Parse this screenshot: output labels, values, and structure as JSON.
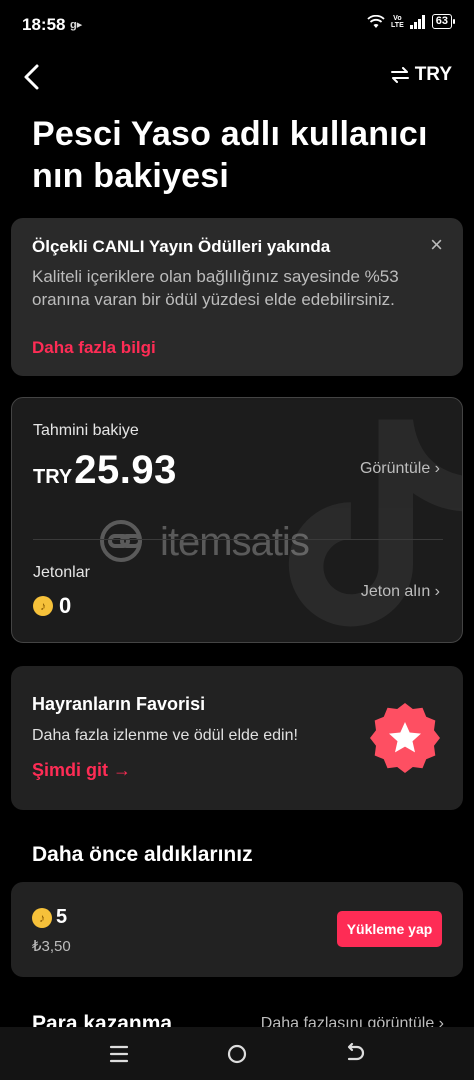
{
  "status_bar": {
    "time": "18:58",
    "network_label": "g▸",
    "volte_top": "Vo",
    "volte_bottom": "LTE",
    "battery": "63"
  },
  "header": {
    "currency_label": "TRY"
  },
  "title": "Pesci Yaso adlı kullanıcı nın bakiyesi",
  "notice": {
    "title": "Ölçekli CANLI Yayın Ödülleri yakında",
    "body": "Kaliteli içeriklere olan bağlılığınız sayesinde %53 oranına varan bir ödül yüzdesi elde edebilirsiniz.",
    "link": "Daha fazla bilgi",
    "close": "×"
  },
  "balance": {
    "label": "Tahmini bakiye",
    "currency": "TRY",
    "amount": "25.93",
    "view_link": "Görüntüle ›",
    "coins_label": "Jetonlar",
    "coins_value": "0",
    "buy_link": "Jeton alın ›",
    "watermark": "itemsatis"
  },
  "fans": {
    "title": "Hayranların Favorisi",
    "body": "Daha fazla izlenme ve ödül elde edin!",
    "link": "Şimdi git →"
  },
  "previous": {
    "section_title": "Daha önce aldıklarınız",
    "coins": "5",
    "price": "₺3,50",
    "button": "Yükleme yap"
  },
  "earn": {
    "title": "Para kazanma",
    "link": "Daha fazlasını görüntüle ›"
  },
  "colors": {
    "accent": "#fe2c55",
    "coin": "#f6c13a",
    "background": "#000000"
  }
}
